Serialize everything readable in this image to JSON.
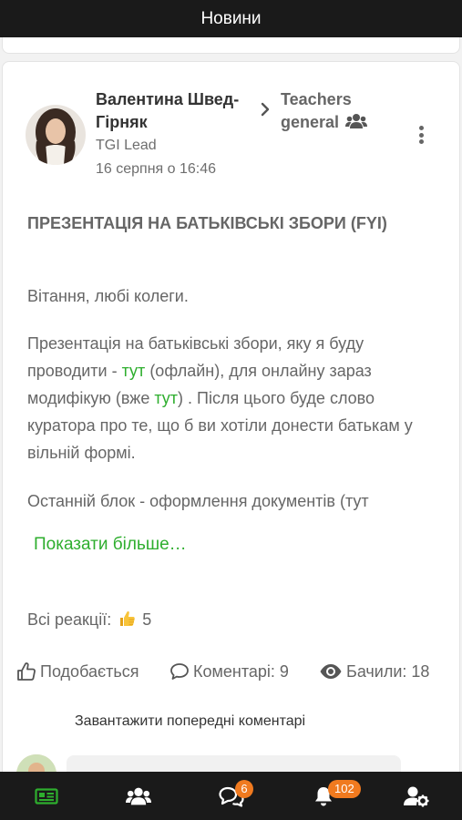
{
  "header": {
    "title": "Новини"
  },
  "post": {
    "author": {
      "name": "Валентина Швед-Гірняк",
      "role": "TGI Lead"
    },
    "date": "16 серпня о 16:46",
    "group": "Teachers general",
    "title": "ПРЕЗЕНТАЦІЯ НА БАТЬКІВСЬКІ ЗБОРИ (FYI)",
    "greeting": "Вітання, любі колеги.",
    "body": {
      "part1": "Презентація на батьківські збори, яку я буду проводити - ",
      "link1": "тут",
      "part2": " (офлайн), для онлайну зараз модифікую (вже ",
      "link2": "тут",
      "part3": ") . Після цього буде слово куратора про те, що б ви хотіли донести батькам у вільній формі."
    },
    "last_block": "Останній блок - оформлення документів (тут",
    "show_more": "Показати більше…",
    "reactions": {
      "label": "Всі реакції:",
      "count": "5"
    },
    "actions": {
      "like": "Подобається",
      "comments": "Коментарі: 9",
      "views": "Бачили: 18"
    },
    "load_previous_comments": "Завантажити попередні коментарі"
  },
  "nav": {
    "chat_badge": "6",
    "notifications_badge": "102"
  },
  "colors": {
    "accent": "#2eae2e",
    "badge": "#f07a1f",
    "bar": "#1a1a1a"
  }
}
